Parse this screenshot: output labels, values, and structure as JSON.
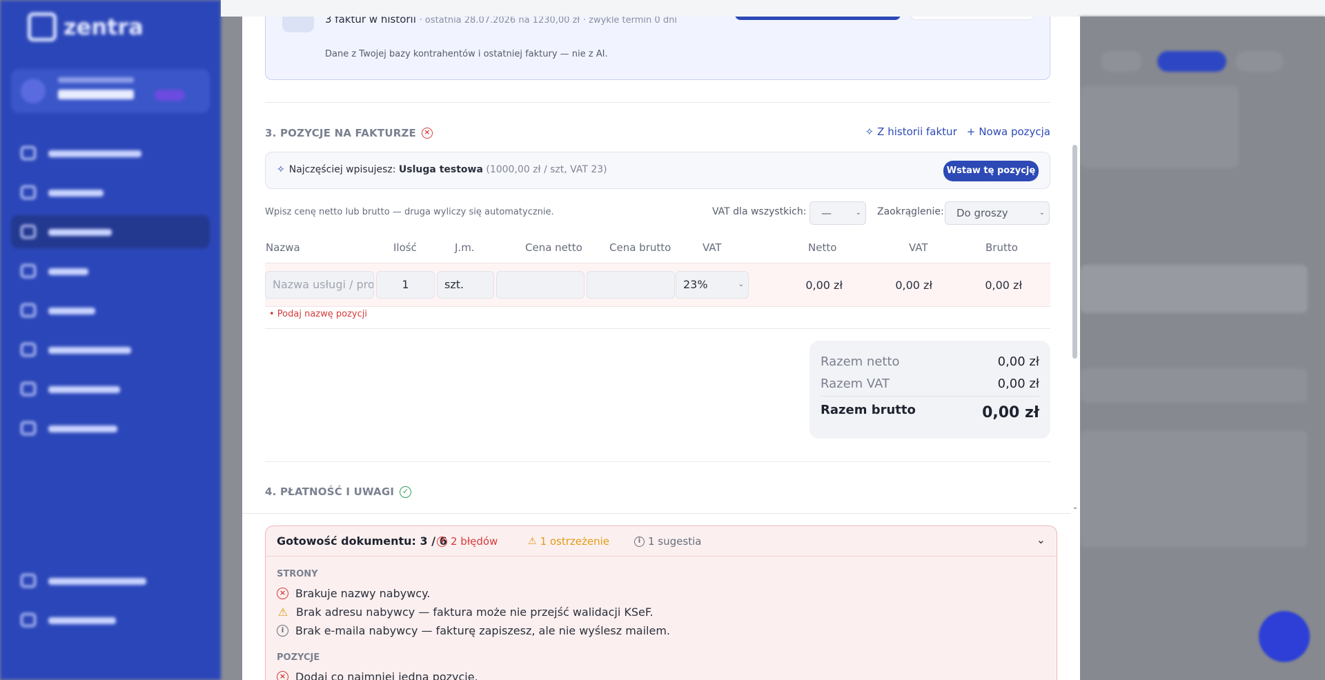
{
  "sidebar": {
    "logo_text": "zentra",
    "nav_item_count": 8,
    "bottom_item_count": 2
  },
  "buyer_history": {
    "summary": "3 faktur w historii",
    "last_invoice": "· ostatnia 28.07.2026 na 1230,00 zł",
    "usual_term": "· zwykle termin 0 dni",
    "source_note": "Dane z Twojej bazy kontrahentów i ostatniej faktury — nie z AI."
  },
  "items_section": {
    "title": "3. POZYCJE NA FAKTURZE",
    "status_icon": "x-circle-icon",
    "from_history_label": "Z historii faktur",
    "new_item_label": "Nowa pozycja",
    "suggestion": {
      "prefix": "Najczęściej wpisujesz:",
      "name": "Usluga testowa",
      "details": "(1000,00 zł / szt, VAT 23)",
      "insert_label": "Wstaw tę pozycję"
    },
    "hint": "Wpisz cenę netto lub brutto — druga wyliczy się automatycznie.",
    "vat_all_label": "VAT dla wszystkich:",
    "vat_all_value": "—",
    "rounding_label": "Zaokrąglenie:",
    "rounding_value": "Do groszy",
    "columns": {
      "name": "Nazwa",
      "qty": "Ilość",
      "unit": "J.m.",
      "net_price": "Cena netto",
      "gross_price": "Cena brutto",
      "vat": "VAT",
      "net": "Netto",
      "vat_amount": "VAT",
      "gross": "Brutto"
    },
    "row": {
      "name_placeholder": "Nazwa usługi / produktu",
      "qty": "1",
      "unit": "szt.",
      "net_price": "",
      "gross_price": "",
      "vat_rate": "23%",
      "net": "0,00 zł",
      "vat_amount": "0,00 zł",
      "gross": "0,00 zł"
    },
    "error": "• Podaj nazwę pozycji",
    "totals": {
      "net_label": "Razem netto",
      "net_value": "0,00 zł",
      "vat_label": "Razem VAT",
      "vat_value": "0,00 zł",
      "gross_label": "Razem brutto",
      "gross_value": "0,00 zł"
    }
  },
  "payment_section": {
    "title": "4. PŁATNOŚĆ I UWAGI",
    "status_icon": "check-circle-icon"
  },
  "readiness": {
    "title": "Gotowość dokumentu: 3 / 6",
    "errors": "2 błędów",
    "warnings": "1 ostrzeżenie",
    "suggestions": "1 sugestia",
    "groups": [
      {
        "name": "STRONY",
        "items": [
          {
            "type": "error",
            "text": "Brakuje nazwy nabywcy."
          },
          {
            "type": "warning",
            "text": "Brak adresu nabywcy — faktura może nie przejść walidacji KSeF."
          },
          {
            "type": "info",
            "text": "Brak e-maila nabywcy — fakturę zapiszesz, ale nie wyślesz mailem."
          }
        ]
      },
      {
        "name": "POZYCJE",
        "items": [
          {
            "type": "error",
            "text": "Dodaj co najmniej jedną pozycję."
          }
        ]
      }
    ]
  },
  "colors": {
    "accent": "#2c49b6",
    "sidebar": "#2b46b8",
    "error": "#d63a3a",
    "warning": "#e29a15",
    "success": "#2e9e5a"
  }
}
